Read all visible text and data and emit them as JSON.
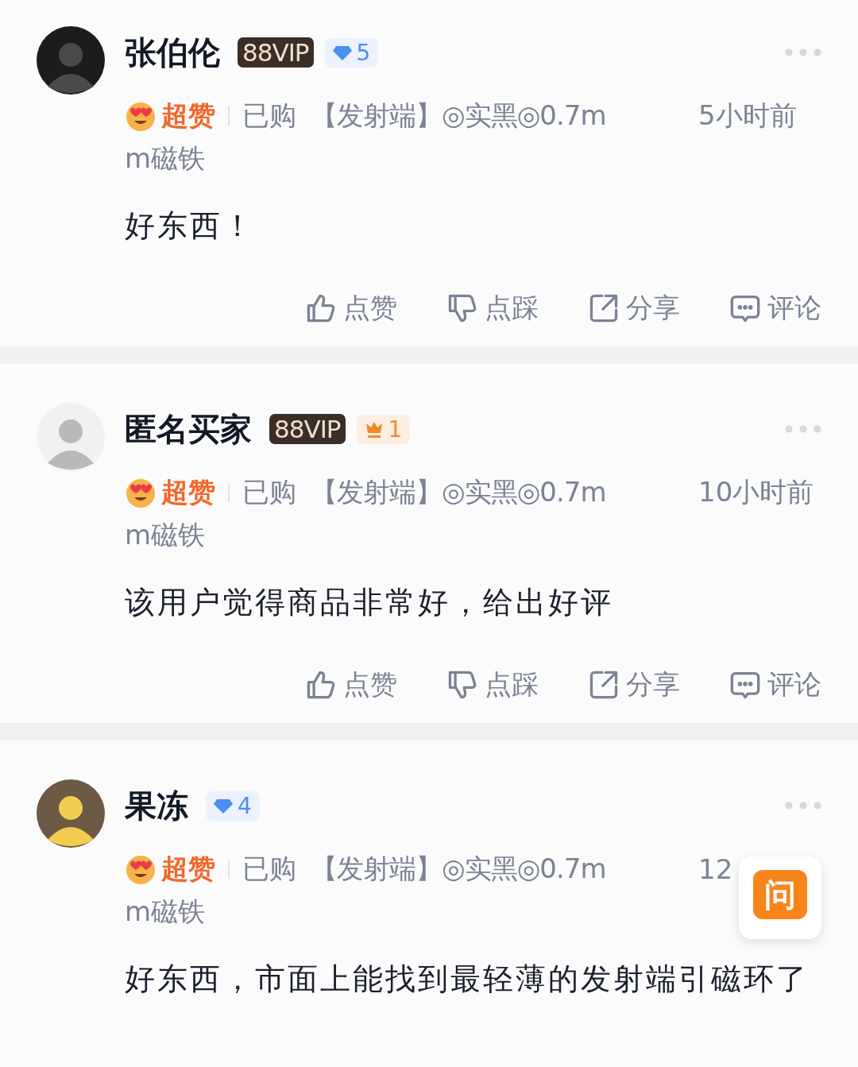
{
  "reviews": [
    {
      "user": "张伯伦",
      "badges": [
        {
          "kind": "vip",
          "text": "88VIP"
        },
        {
          "kind": "diamond",
          "text": "5"
        }
      ],
      "rating": "超赞",
      "purchased": "已购",
      "product": "【发射端】◎实黑◎0.7m",
      "product_cont": "m磁铁",
      "time": "5小时前",
      "text": "好东西！",
      "actions": [
        "点赞",
        "点踩",
        "分享",
        "评论"
      ]
    },
    {
      "user": "匿名买家",
      "badges": [
        {
          "kind": "vip",
          "text": "88VIP"
        },
        {
          "kind": "crown",
          "text": "1"
        }
      ],
      "rating": "超赞",
      "purchased": "已购",
      "product": "【发射端】◎实黑◎0.7m",
      "product_cont": "m磁铁",
      "time": "10小时前",
      "text": "该用户觉得商品非常好，给出好评",
      "actions": [
        "点赞",
        "点踩",
        "分享",
        "评论"
      ]
    },
    {
      "user": "果冻",
      "badges": [
        {
          "kind": "diamond",
          "text": "4"
        }
      ],
      "rating": "超赞",
      "purchased": "已购",
      "product": "【发射端】◎实黑◎0.7m",
      "product_cont": "m磁铁",
      "time": "12",
      "text": "好东西，市面上能找到最轻薄的发射端引磁环了"
    }
  ],
  "float_button": {
    "text": "问"
  }
}
